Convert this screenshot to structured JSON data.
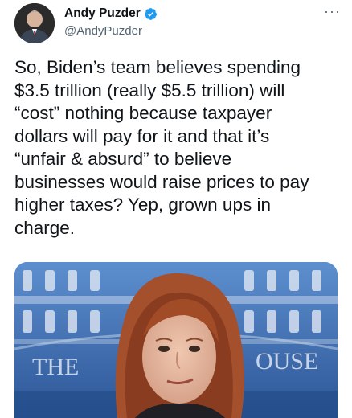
{
  "author": {
    "display_name": "Andy Puzder",
    "handle": "@AndyPuzder",
    "verified": true,
    "avatar_icon": "person-avatar"
  },
  "more_icon": "ellipsis-icon",
  "tweet": {
    "text": "So, Biden’s team believes spending\n$3.5 trillion (really $5.5 trillion) will\n“cost” nothing because taxpayer\ndollars will pay for it and that it’s\n“unfair & absurd” to believe\nbusinesses would raise prices to pay\nhigher taxes? Yep, grown ups in\ncharge."
  },
  "media": {
    "backdrop_text_left": "THE",
    "backdrop_text_right": "OUSE",
    "colors": {
      "backdrop_blue": "#3f6fb0",
      "window_white": "#e9eef6",
      "hair": "#9c4a2a",
      "skin": "#e3b59c"
    }
  },
  "colors": {
    "text_primary": "#0f1419",
    "text_secondary": "#536471",
    "verified_blue": "#1d9bf0"
  }
}
